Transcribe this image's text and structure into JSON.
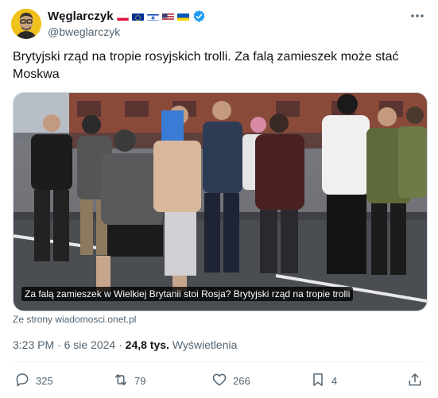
{
  "author": {
    "name": "Węglarczyk",
    "handle": "@bweglarczyk",
    "flags": [
      "pl-flag-icon",
      "eu-flag-icon",
      "il-flag-icon",
      "us-flag-icon",
      "ua-flag-icon"
    ],
    "verified_icon": "verified-badge-icon"
  },
  "tweet": {
    "text": "Brytyjski rząd na tropie rosyjskich trolli. Za falą zamieszek może stać Moskwa"
  },
  "card": {
    "caption": "Za falą zamieszek w Wielkiej Brytanii stoi Rosja? Brytyjski rząd na tropie trolli",
    "source": "Ze strony wiadomosci.onet.pl"
  },
  "meta": {
    "time": "3:23 PM",
    "sep": "·",
    "date": "6 sie 2024",
    "views_count": "24,8 tys.",
    "views_label": "Wyświetlenia"
  },
  "actions": {
    "replies": "325",
    "reposts": "79",
    "likes": "266",
    "bookmarks": "4"
  },
  "colors": {
    "text": "#0f1419",
    "secondary": "#536471",
    "verified": "#1d9bf0"
  }
}
